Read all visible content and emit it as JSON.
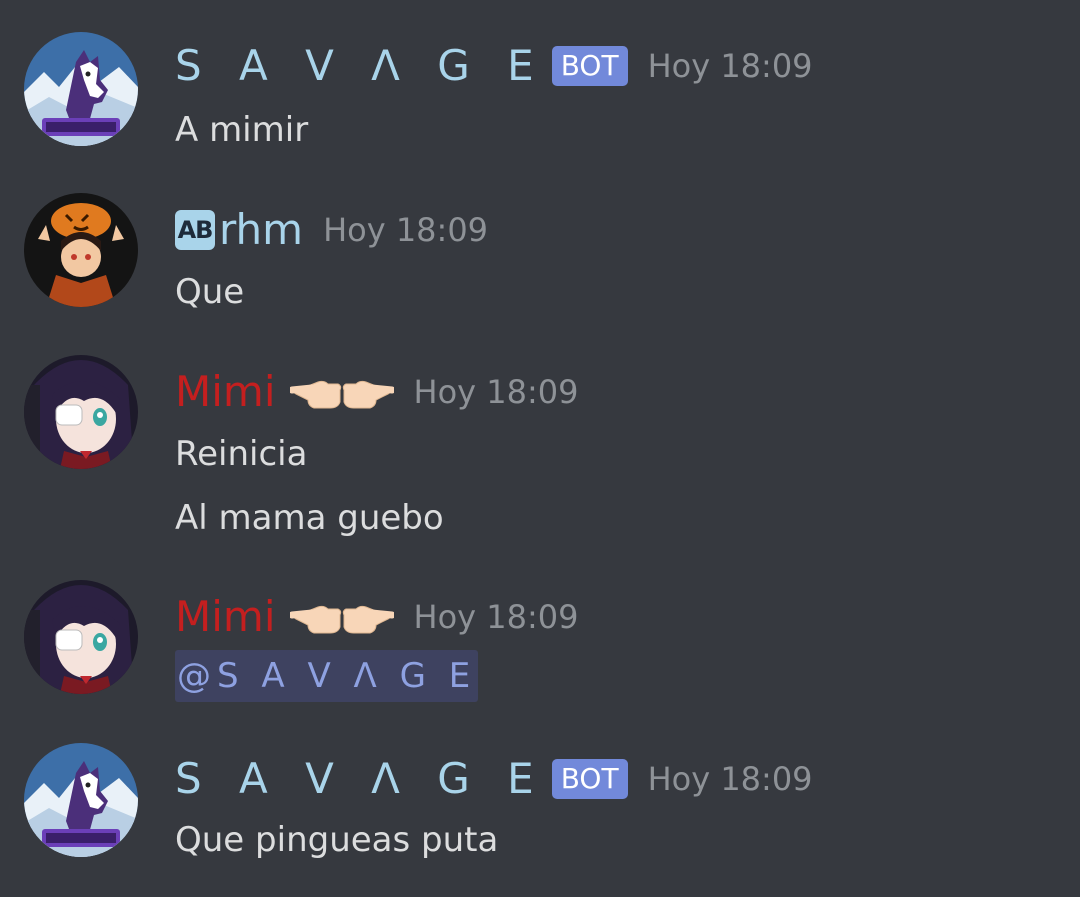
{
  "messages": [
    {
      "author": "S A V Λ G E",
      "tag": "BOT",
      "time": "Hoy 18:09",
      "lines": [
        "A mimir"
      ],
      "avatar_icon": "wolf-savage-logo-icon"
    },
    {
      "badge": "AB",
      "author": "rhm",
      "time": "Hoy 18:09",
      "lines": [
        "Que"
      ],
      "avatar_icon": "pumpkin-anime-avatar-icon"
    },
    {
      "author": "Mimi",
      "emoji": "backhand-index-pointing-left-right",
      "time": "Hoy 18:09",
      "lines": [
        "Reinicia",
        "Al mama guebo"
      ],
      "avatar_icon": "anime-girl-eyepatch-avatar-icon"
    },
    {
      "author": "Mimi",
      "emoji": "backhand-index-pointing-left-right",
      "time": "Hoy 18:09",
      "mention": "@S A V Λ G E",
      "avatar_icon": "anime-girl-eyepatch-avatar-icon"
    },
    {
      "author": "S A V Λ G E",
      "tag": "BOT",
      "time": "Hoy 18:09",
      "lines": [
        "Que pingueas puta"
      ],
      "avatar_icon": "wolf-savage-logo-icon"
    }
  ],
  "colors": {
    "background": "#36393f",
    "savage_name": "#a9d4ea",
    "mimi_name": "#c41f1f",
    "bot_tag": "#7289da",
    "timestamp": "#8e9297",
    "message_text": "#dcddde",
    "mention_bg": "#3e4260",
    "mention_text": "#8ea1e1"
  }
}
